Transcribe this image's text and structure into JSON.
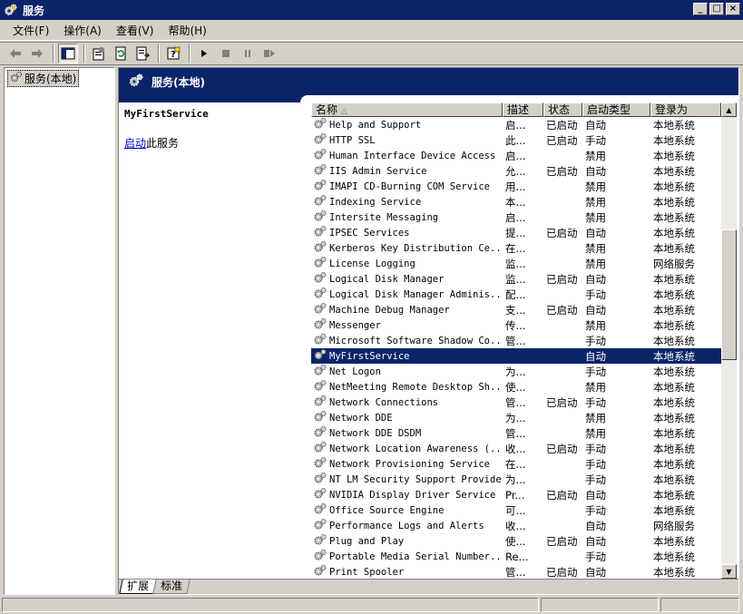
{
  "window": {
    "title": "服务",
    "buttons": {
      "minimize": "_",
      "maximize": "□",
      "close": "×"
    }
  },
  "menubar": [
    "文件(F)",
    "操作(A)",
    "查看(V)",
    "帮助(H)"
  ],
  "tree": {
    "root_label": "服务(本地)"
  },
  "banner": {
    "title": "服务(本地)"
  },
  "description_pane": {
    "service_name": "MyFirstService",
    "action_link": "启动",
    "action_suffix": "此服务"
  },
  "list": {
    "headers": {
      "name": "名称",
      "description": "描述",
      "status": "状态",
      "startup_type": "启动类型",
      "logon_as": "登录为"
    },
    "selected_index": 15,
    "rows": [
      {
        "name": "Help and Support",
        "desc": "启...",
        "status": "已启动",
        "type": "自动",
        "logon": "本地系统"
      },
      {
        "name": "HTTP SSL",
        "desc": "此...",
        "status": "已启动",
        "type": "手动",
        "logon": "本地系统"
      },
      {
        "name": "Human Interface Device Access",
        "desc": "启...",
        "status": "",
        "type": "禁用",
        "logon": "本地系统"
      },
      {
        "name": "IIS Admin Service",
        "desc": "允...",
        "status": "已启动",
        "type": "自动",
        "logon": "本地系统"
      },
      {
        "name": "IMAPI CD-Burning COM Service",
        "desc": "用...",
        "status": "",
        "type": "禁用",
        "logon": "本地系统"
      },
      {
        "name": "Indexing Service",
        "desc": "本...",
        "status": "",
        "type": "禁用",
        "logon": "本地系统"
      },
      {
        "name": "Intersite Messaging",
        "desc": "启...",
        "status": "",
        "type": "禁用",
        "logon": "本地系统"
      },
      {
        "name": "IPSEC Services",
        "desc": "提...",
        "status": "已启动",
        "type": "自动",
        "logon": "本地系统"
      },
      {
        "name": "Kerberos Key Distribution Ce...",
        "desc": "在...",
        "status": "",
        "type": "禁用",
        "logon": "本地系统"
      },
      {
        "name": "License Logging",
        "desc": "监...",
        "status": "",
        "type": "禁用",
        "logon": "网络服务"
      },
      {
        "name": "Logical Disk Manager",
        "desc": "监...",
        "status": "已启动",
        "type": "自动",
        "logon": "本地系统"
      },
      {
        "name": "Logical Disk Manager Adminis...",
        "desc": "配...",
        "status": "",
        "type": "手动",
        "logon": "本地系统"
      },
      {
        "name": "Machine Debug Manager",
        "desc": "支...",
        "status": "已启动",
        "type": "自动",
        "logon": "本地系统"
      },
      {
        "name": "Messenger",
        "desc": "传...",
        "status": "",
        "type": "禁用",
        "logon": "本地系统"
      },
      {
        "name": "Microsoft Software Shadow Co...",
        "desc": "管...",
        "status": "",
        "type": "手动",
        "logon": "本地系统"
      },
      {
        "name": "MyFirstService",
        "desc": "",
        "status": "",
        "type": "自动",
        "logon": "本地系统"
      },
      {
        "name": "Net Logon",
        "desc": "为...",
        "status": "",
        "type": "手动",
        "logon": "本地系统"
      },
      {
        "name": "NetMeeting Remote Desktop Sh...",
        "desc": "使...",
        "status": "",
        "type": "禁用",
        "logon": "本地系统"
      },
      {
        "name": "Network Connections",
        "desc": "管...",
        "status": "已启动",
        "type": "手动",
        "logon": "本地系统"
      },
      {
        "name": "Network DDE",
        "desc": "为...",
        "status": "",
        "type": "禁用",
        "logon": "本地系统"
      },
      {
        "name": "Network DDE DSDM",
        "desc": "管...",
        "status": "",
        "type": "禁用",
        "logon": "本地系统"
      },
      {
        "name": "Network Location Awareness (...",
        "desc": "收...",
        "status": "已启动",
        "type": "手动",
        "logon": "本地系统"
      },
      {
        "name": "Network Provisioning Service",
        "desc": "在...",
        "status": "",
        "type": "手动",
        "logon": "本地系统"
      },
      {
        "name": "NT LM Security Support Provider",
        "desc": "为...",
        "status": "",
        "type": "手动",
        "logon": "本地系统"
      },
      {
        "name": "NVIDIA Display Driver Service",
        "desc": "Pr...",
        "status": "已启动",
        "type": "自动",
        "logon": "本地系统"
      },
      {
        "name": "Office Source Engine",
        "desc": "可...",
        "status": "",
        "type": "手动",
        "logon": "本地系统"
      },
      {
        "name": "Performance Logs and Alerts",
        "desc": "收...",
        "status": "",
        "type": "自动",
        "logon": "网络服务"
      },
      {
        "name": "Plug and Play",
        "desc": "使...",
        "status": "已启动",
        "type": "自动",
        "logon": "本地系统"
      },
      {
        "name": "Portable Media Serial Number...",
        "desc": "Re...",
        "status": "",
        "type": "手动",
        "logon": "本地系统"
      },
      {
        "name": "Print Spooler",
        "desc": "管...",
        "status": "已启动",
        "type": "自动",
        "logon": "本地系统"
      }
    ]
  },
  "tabs": [
    "扩展",
    "标准"
  ],
  "active_tab": "扩展"
}
